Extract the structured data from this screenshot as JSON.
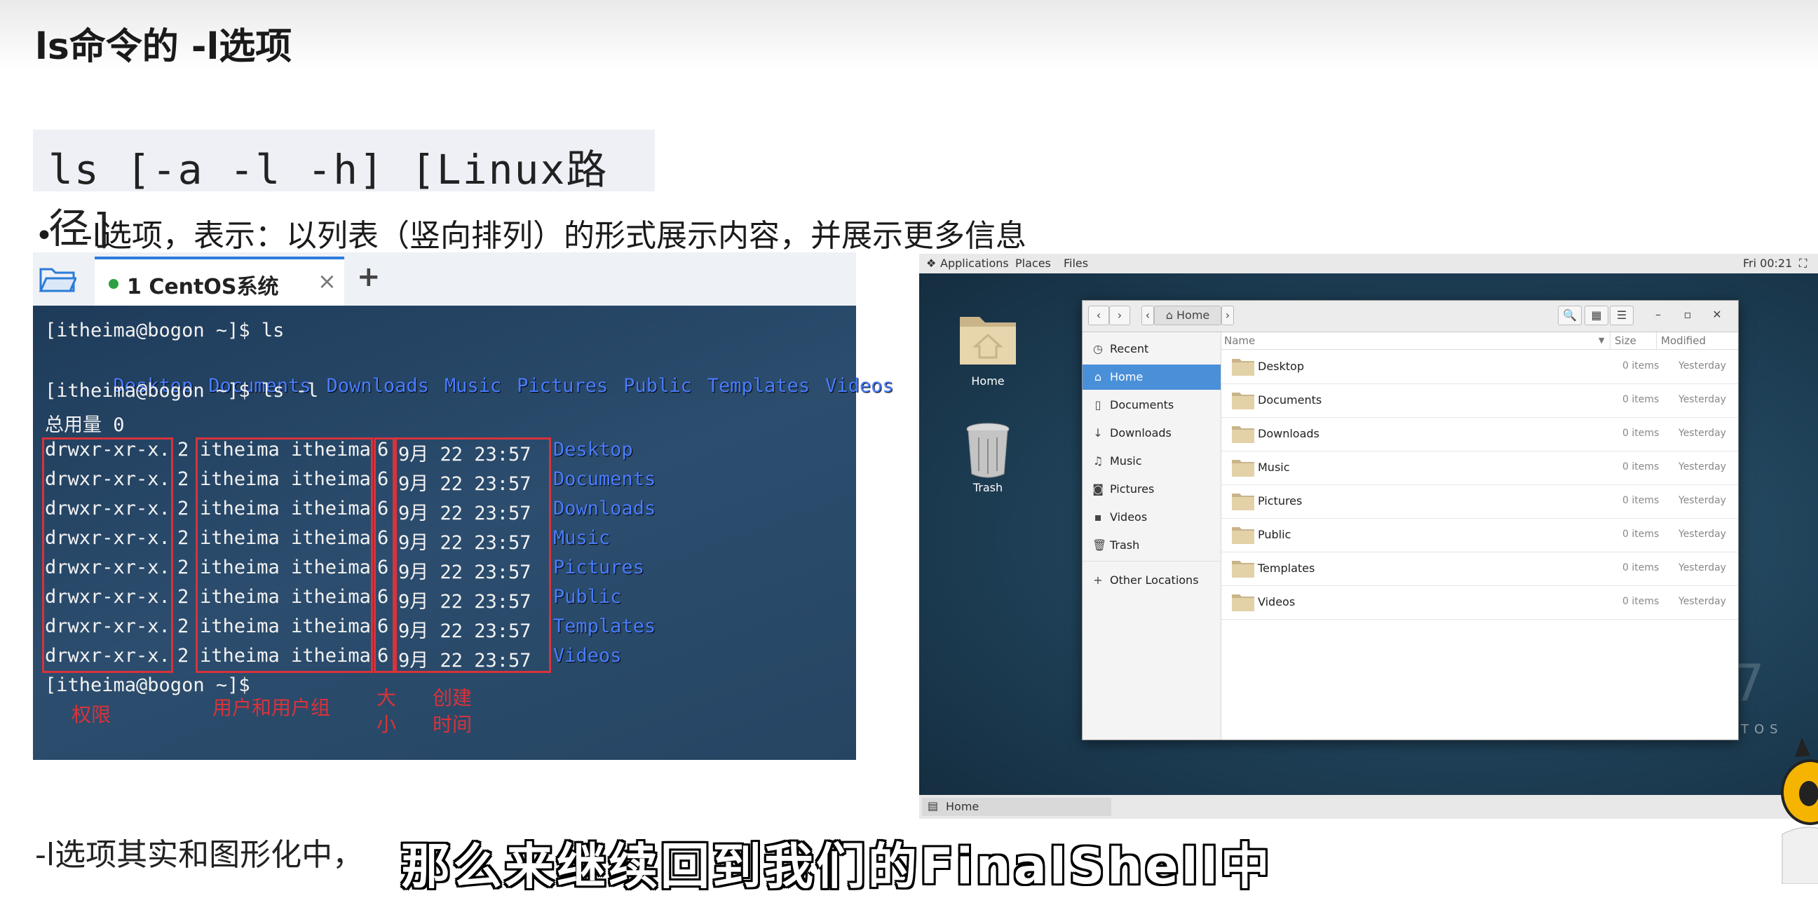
{
  "slide": {
    "title": "ls命令的 -l选项",
    "command_syntax": "ls [-a -l -h] [Linux路径]",
    "bullet_text": "-l选项，表示：以列表（竖向排列）的形式展示内容，并展示更多信息",
    "bottom_text": "-l选项其实和图形化中，",
    "subtitle": "那么来继续回到我们的FinalShell中"
  },
  "terminal": {
    "tab_label": "1 CentOS系统",
    "tab_close": "×",
    "tab_add": "+",
    "prompt_ls": "[itheima@bogon ~]$ ls",
    "ls_items": [
      "Desktop",
      "Documents",
      "Downloads",
      "Music",
      "Pictures",
      "Public",
      "Templates",
      "Videos"
    ],
    "prompt_lsl": "[itheima@bogon ~]$ ls -l",
    "total": "总用量 0",
    "rows": [
      {
        "perm": "drwxr-xr-x.",
        "links": "2",
        "owner": "itheima itheima",
        "size": "6",
        "date": "9月   22 23:57",
        "name": "Desktop"
      },
      {
        "perm": "drwxr-xr-x.",
        "links": "2",
        "owner": "itheima itheima",
        "size": "6",
        "date": "9月   22 23:57",
        "name": "Documents"
      },
      {
        "perm": "drwxr-xr-x.",
        "links": "2",
        "owner": "itheima itheima",
        "size": "6",
        "date": "9月   22 23:57",
        "name": "Downloads"
      },
      {
        "perm": "drwxr-xr-x.",
        "links": "2",
        "owner": "itheima itheima",
        "size": "6",
        "date": "9月   22 23:57",
        "name": "Music"
      },
      {
        "perm": "drwxr-xr-x.",
        "links": "2",
        "owner": "itheima itheima",
        "size": "6",
        "date": "9月   22 23:57",
        "name": "Pictures"
      },
      {
        "perm": "drwxr-xr-x.",
        "links": "2",
        "owner": "itheima itheima",
        "size": "6",
        "date": "9月   22 23:57",
        "name": "Public"
      },
      {
        "perm": "drwxr-xr-x.",
        "links": "2",
        "owner": "itheima itheima",
        "size": "6",
        "date": "9月   22 23:57",
        "name": "Templates"
      },
      {
        "perm": "drwxr-xr-x.",
        "links": "2",
        "owner": "itheima itheima",
        "size": "6",
        "date": "9月   22 23:57",
        "name": "Videos"
      }
    ],
    "prompt_end": "[itheima@bogon ~]$",
    "annotations": {
      "permissions": "权限",
      "user_group": "用户和用户组",
      "size_1": "大",
      "size_2": "小",
      "time_1": "创建",
      "time_2": "时间"
    }
  },
  "desktop": {
    "topbar": {
      "applications": "Applications",
      "places": "Places",
      "files": "Files",
      "clock": "Fri 00:21"
    },
    "icons": {
      "home": "Home",
      "trash": "Trash"
    },
    "taskbar_item": "Home",
    "watermark_number": "7",
    "watermark_os": "TOS",
    "file_manager": {
      "location": "Home",
      "sidebar": [
        {
          "icon": "clock-icon",
          "glyph": "◷",
          "label": "Recent"
        },
        {
          "icon": "home-icon",
          "glyph": "⌂",
          "label": "Home"
        },
        {
          "icon": "document-icon",
          "glyph": "▯",
          "label": "Documents"
        },
        {
          "icon": "download-icon",
          "glyph": "↓",
          "label": "Downloads"
        },
        {
          "icon": "music-icon",
          "glyph": "♫",
          "label": "Music"
        },
        {
          "icon": "camera-icon",
          "glyph": "◙",
          "label": "Pictures"
        },
        {
          "icon": "video-icon",
          "glyph": "▪",
          "label": "Videos"
        },
        {
          "icon": "trash-icon",
          "glyph": "🗑",
          "label": "Trash"
        },
        {
          "icon": "plus-icon",
          "glyph": "+",
          "label": "Other Locations"
        }
      ],
      "columns": {
        "name": "Name",
        "size": "Size",
        "modified": "Modified"
      },
      "files": [
        {
          "name": "Desktop",
          "size": "0 items",
          "modified": "Yesterday"
        },
        {
          "name": "Documents",
          "size": "0 items",
          "modified": "Yesterday"
        },
        {
          "name": "Downloads",
          "size": "0 items",
          "modified": "Yesterday"
        },
        {
          "name": "Music",
          "size": "0 items",
          "modified": "Yesterday"
        },
        {
          "name": "Pictures",
          "size": "0 items",
          "modified": "Yesterday"
        },
        {
          "name": "Public",
          "size": "0 items",
          "modified": "Yesterday"
        },
        {
          "name": "Templates",
          "size": "0 items",
          "modified": "Yesterday"
        },
        {
          "name": "Videos",
          "size": "0 items",
          "modified": "Yesterday"
        }
      ]
    }
  },
  "colors": {
    "annotation_red": "#d8333a",
    "terminal_blue": "#4a7dff",
    "selection_blue": "#4a90d9"
  }
}
